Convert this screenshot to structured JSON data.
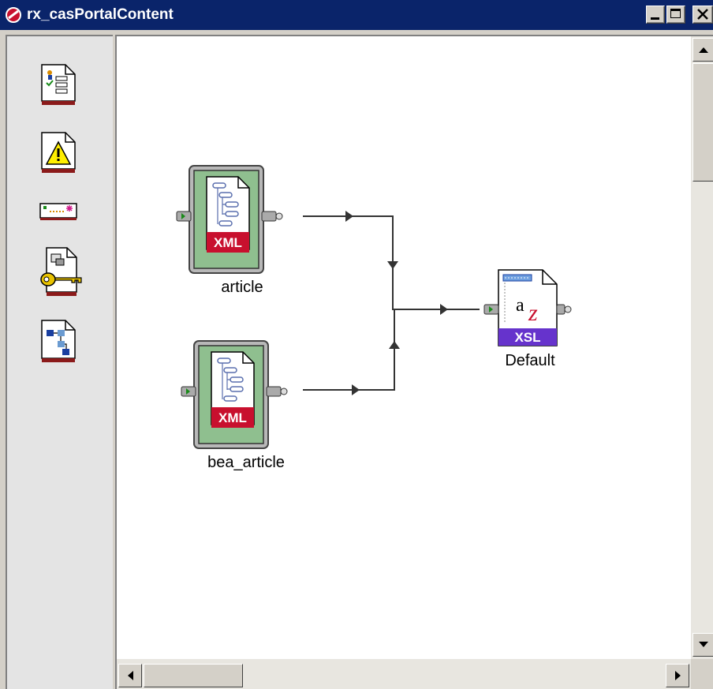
{
  "window": {
    "title": "rx_casPortalContent"
  },
  "titlebar_buttons": [
    "minimize",
    "maximize",
    "close"
  ],
  "palette": [
    {
      "name": "form-icon"
    },
    {
      "name": "warning-icon"
    },
    {
      "name": "field-icon"
    },
    {
      "name": "key-icon"
    },
    {
      "name": "tree-icon"
    }
  ],
  "nodes": {
    "article": {
      "label": "article",
      "badge": "XML"
    },
    "bea_article": {
      "label": "bea_article",
      "badge": "XML"
    },
    "default": {
      "label": "Default",
      "badge": "XSL",
      "glyph_a": "a",
      "glyph_z": "z"
    }
  },
  "colors": {
    "titlebar": "#0a246a",
    "xml_badge": "#c8102e",
    "xsl_badge": "#6633cc",
    "node_frame": "#8fbf8f"
  }
}
